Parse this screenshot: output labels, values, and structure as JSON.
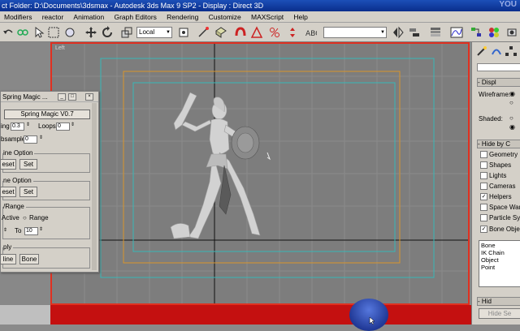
{
  "window": {
    "title": "ct Folder: D:\\Documents\\3dsmax      - Autodesk 3ds Max 9 SP2       - Display : Direct 3D",
    "watermark": "YOU"
  },
  "menu": [
    "Modifiers",
    "reactor",
    "Animation",
    "Graph Editors",
    "Rendering",
    "Customize",
    "MAXScript",
    "Help"
  ],
  "toolbar": {
    "coord_system": "Local",
    "selection_set": ""
  },
  "viewport": {
    "label": "Left"
  },
  "dialog": {
    "title": "Spring Magic ...",
    "heading": "Spring Magic V0.7",
    "spring_label": "ing",
    "spring_value": "0.3",
    "loops_label": "Loops",
    "loops_value": "0",
    "subsample_label": "bsample",
    "subsample_value": "0",
    "group1": "ine Option",
    "reset1": "eset",
    "set1": "Set",
    "group2": "ne Option",
    "reset2": "eset",
    "set2": "Set",
    "group3": "/Range",
    "active_label": "Active",
    "range_label": "Range",
    "to_label": "To",
    "to_value": "10",
    "group4": "ply",
    "apply_spline": "line",
    "apply_bone": "Bone"
  },
  "panel": {
    "display_rollout": "Displ",
    "wireframe_label": "Wireframe:",
    "shaded_label": "Shaded:",
    "hide_by_rollout": "Hide by C",
    "checkboxes": [
      {
        "label": "Geometry",
        "checked": false
      },
      {
        "label": "Shapes",
        "checked": false
      },
      {
        "label": "Lights",
        "checked": false
      },
      {
        "label": "Cameras",
        "checked": false
      },
      {
        "label": "Helpers",
        "checked": true
      },
      {
        "label": "Space Warp",
        "checked": false
      },
      {
        "label": "Particle Syst",
        "checked": false
      },
      {
        "label": "Bone Object",
        "checked": true
      }
    ],
    "list_items": [
      "Bone",
      "IK Chain Object",
      "Point"
    ],
    "hide_rollout": "Hid",
    "hide_selected": "Hide Se"
  },
  "colors": {
    "viewport_border": "#e03020",
    "safe_frame_cyan": "#38b8b8",
    "safe_frame_orange": "#d9952a",
    "status_bar": "#c41010"
  }
}
